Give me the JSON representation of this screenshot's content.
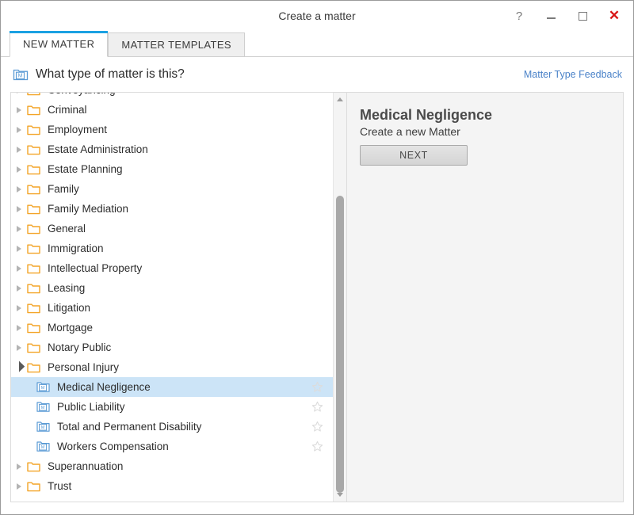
{
  "window": {
    "title": "Create a matter",
    "controls": [
      {
        "name": "help-button",
        "glyph": "?"
      },
      {
        "name": "minimize-button",
        "glyph": "minimize-icon"
      },
      {
        "name": "maximize-button",
        "glyph": "maximize-icon"
      },
      {
        "name": "close-button",
        "glyph": "✕"
      }
    ]
  },
  "tabs": [
    {
      "label": "NEW MATTER",
      "active": true
    },
    {
      "label": "MATTER TEMPLATES",
      "active": false
    }
  ],
  "subheader": {
    "icon": "matter-folder-icon",
    "title": "What type of matter is this?",
    "feedback_link": "Matter Type Feedback"
  },
  "tree": {
    "items": [
      {
        "label": "Conveyancing",
        "level": 0,
        "state": "collapsed",
        "icon": "folder-icon",
        "clipped": true
      },
      {
        "label": "Criminal",
        "level": 0,
        "state": "collapsed",
        "icon": "folder-icon"
      },
      {
        "label": "Employment",
        "level": 0,
        "state": "collapsed",
        "icon": "folder-icon"
      },
      {
        "label": "Estate Administration",
        "level": 0,
        "state": "collapsed",
        "icon": "folder-icon"
      },
      {
        "label": "Estate Planning",
        "level": 0,
        "state": "collapsed",
        "icon": "folder-icon"
      },
      {
        "label": "Family",
        "level": 0,
        "state": "collapsed",
        "icon": "folder-icon"
      },
      {
        "label": "Family Mediation",
        "level": 0,
        "state": "collapsed",
        "icon": "folder-icon"
      },
      {
        "label": "General",
        "level": 0,
        "state": "collapsed",
        "icon": "folder-icon"
      },
      {
        "label": "Immigration",
        "level": 0,
        "state": "collapsed",
        "icon": "folder-icon"
      },
      {
        "label": "Intellectual Property",
        "level": 0,
        "state": "collapsed",
        "icon": "folder-icon"
      },
      {
        "label": "Leasing",
        "level": 0,
        "state": "collapsed",
        "icon": "folder-icon"
      },
      {
        "label": "Litigation",
        "level": 0,
        "state": "collapsed",
        "icon": "folder-icon"
      },
      {
        "label": "Mortgage",
        "level": 0,
        "state": "collapsed",
        "icon": "folder-icon"
      },
      {
        "label": "Notary Public",
        "level": 0,
        "state": "collapsed",
        "icon": "folder-icon"
      },
      {
        "label": "Personal Injury",
        "level": 0,
        "state": "expanded",
        "icon": "folder-icon"
      },
      {
        "label": "Medical Negligence",
        "level": 1,
        "state": "leaf",
        "icon": "matter-type-icon",
        "selected": true,
        "favorite": false
      },
      {
        "label": "Public Liability",
        "level": 1,
        "state": "leaf",
        "icon": "matter-type-icon",
        "selected": false,
        "favorite": false
      },
      {
        "label": "Total and Permanent Disability",
        "level": 1,
        "state": "leaf",
        "icon": "matter-type-icon",
        "selected": false,
        "favorite": false
      },
      {
        "label": "Workers Compensation",
        "level": 1,
        "state": "leaf",
        "icon": "matter-type-icon",
        "selected": false,
        "favorite": false
      },
      {
        "label": "Superannuation",
        "level": 0,
        "state": "collapsed",
        "icon": "folder-icon"
      },
      {
        "label": "Trust",
        "level": 0,
        "state": "collapsed",
        "icon": "folder-icon"
      }
    ]
  },
  "detail": {
    "title": "Medical Negligence",
    "subtitle": "Create a new Matter",
    "next_label": "NEXT"
  },
  "colors": {
    "accent": "#1ba1e2",
    "folder": "#f3a427",
    "matter_icon": "#5b9bd5",
    "selection": "#cce4f7",
    "link": "#4a82c8",
    "close": "#d81616"
  }
}
